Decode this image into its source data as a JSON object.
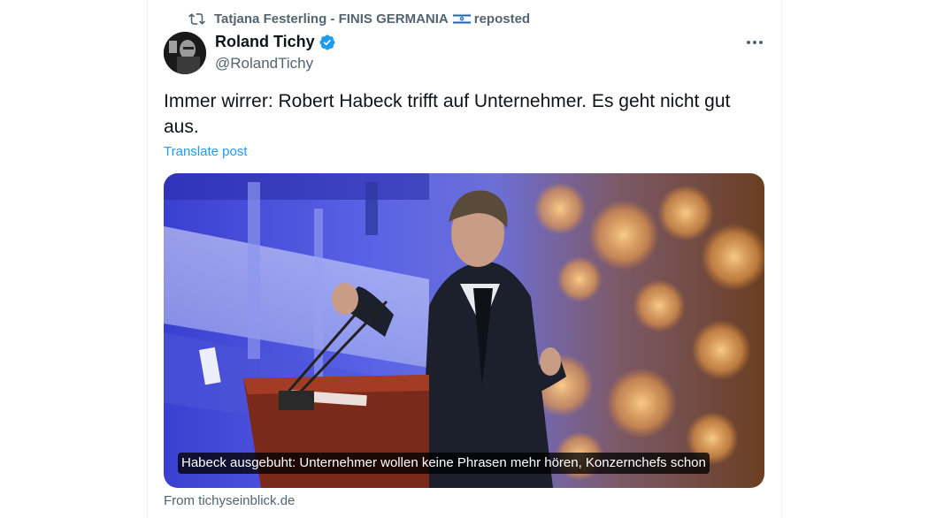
{
  "repost": {
    "icon": "repost-icon",
    "reposter": "Tatjana Festerling - FINIS GERMANIA",
    "flag": "israel-flag-icon",
    "suffix": "reposted"
  },
  "author": {
    "name": "Roland Tichy",
    "handle": "@RolandTichy",
    "verified": true,
    "verified_color": "#1d9bf0"
  },
  "post": {
    "text": "Immer wirrer: Robert Habeck trifft auf Unternehmer. Es geht nicht gut aus.",
    "translate_label": "Translate post"
  },
  "link_card": {
    "caption": "Habeck ausgebuht: Unternehmer wollen keine Phrasen mehr hören, Konzernchefs schon",
    "source": "From tichyseinblick.de"
  },
  "colors": {
    "text_primary": "#0f1419",
    "text_secondary": "#536471",
    "accent": "#1d9bf0"
  }
}
